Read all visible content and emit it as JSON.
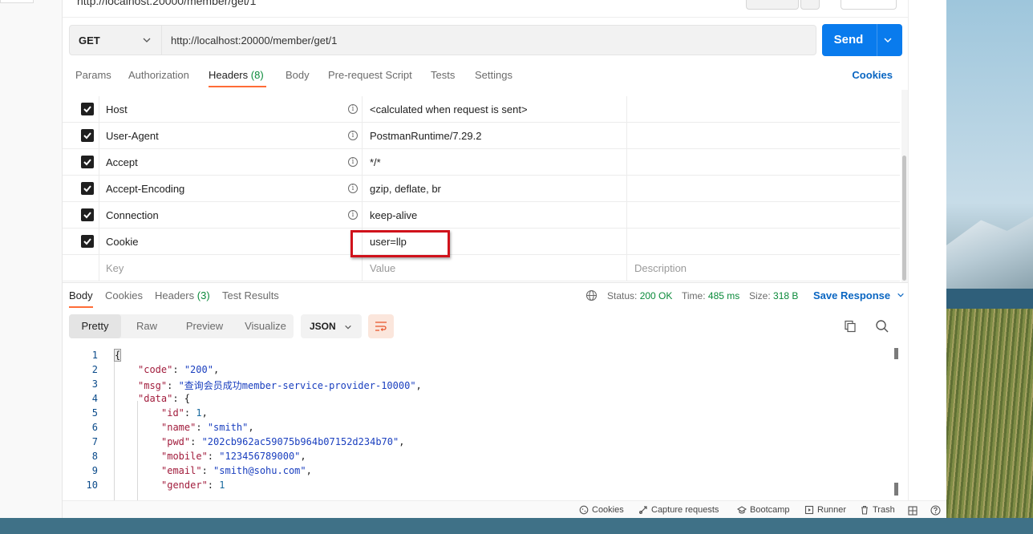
{
  "request": {
    "method": "GET",
    "url": "http://localhost:20000/member/get/1",
    "send_label": "Send"
  },
  "request_tabs": [
    {
      "label": "Params"
    },
    {
      "label": "Authorization"
    },
    {
      "label": "Headers",
      "count": "(8)"
    },
    {
      "label": "Body"
    },
    {
      "label": "Pre-request Script"
    },
    {
      "label": "Tests"
    },
    {
      "label": "Settings"
    }
  ],
  "cookies_link": "Cookies",
  "headers": [
    {
      "key": "Host",
      "value": "<calculated when request is sent>"
    },
    {
      "key": "User-Agent",
      "value": "PostmanRuntime/7.29.2"
    },
    {
      "key": "Accept",
      "value": "*/*"
    },
    {
      "key": "Accept-Encoding",
      "value": "gzip, deflate, br"
    },
    {
      "key": "Connection",
      "value": "keep-alive"
    },
    {
      "key": "Cookie",
      "value": "user=llp"
    }
  ],
  "headers_placeholder": {
    "key": "Key",
    "value": "Value",
    "description": "Description"
  },
  "response_tabs": [
    {
      "label": "Body"
    },
    {
      "label": "Cookies"
    },
    {
      "label": "Headers",
      "count": "(3)"
    },
    {
      "label": "Test Results"
    }
  ],
  "response_meta": {
    "status_label": "Status:",
    "status_value": "200 OK",
    "time_label": "Time:",
    "time_value": "485 ms",
    "size_label": "Size:",
    "size_value": "318 B",
    "save_response": "Save Response"
  },
  "view_modes": [
    "Pretty",
    "Raw",
    "Preview",
    "Visualize"
  ],
  "format": "JSON",
  "code_lines": [
    {
      "n": "1",
      "text": "{"
    },
    {
      "n": "2",
      "key": "\"code\"",
      "str": "\"200\"",
      "tail": ","
    },
    {
      "n": "3",
      "key": "\"msg\"",
      "str": "\"查询会员成功member-service-provider-10000\"",
      "tail": ","
    },
    {
      "n": "4",
      "key": "\"data\"",
      "tail": ": {"
    },
    {
      "n": "5",
      "key": "\"id\"",
      "num": "1",
      "tail": ","
    },
    {
      "n": "6",
      "key": "\"name\"",
      "str": "\"smith\"",
      "tail": ","
    },
    {
      "n": "7",
      "key": "\"pwd\"",
      "str": "\"202cb962ac59075b964b07152d234b70\"",
      "tail": ","
    },
    {
      "n": "8",
      "key": "\"mobile\"",
      "str": "\"123456789000\"",
      "tail": ","
    },
    {
      "n": "9",
      "key": "\"email\"",
      "str": "\"smith@sohu.com\"",
      "tail": ","
    },
    {
      "n": "10",
      "key": "\"gender\"",
      "num": "1",
      "tail": ""
    }
  ],
  "status_bar": [
    "Cookies",
    "Capture requests",
    "Bootcamp",
    "Runner",
    "Trash"
  ],
  "colors": {
    "accent": "#097bed",
    "tab_underline": "#ff6c37",
    "status_ok": "#0a8a3a",
    "highlight": "#d0121b"
  }
}
